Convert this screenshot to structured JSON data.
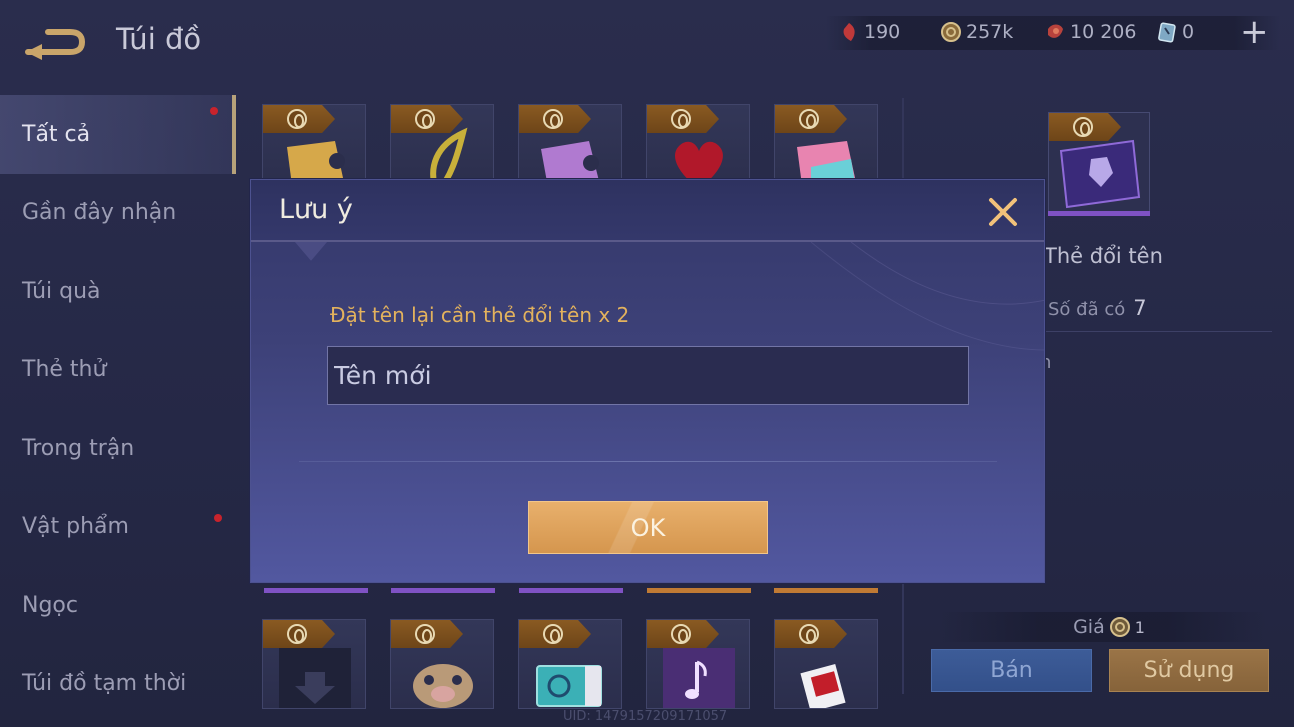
{
  "header": {
    "title": "Túi đồ",
    "currencies": [
      {
        "icon": "ruby-icon",
        "value": "190"
      },
      {
        "icon": "gold-coin-icon",
        "value": "257k"
      },
      {
        "icon": "voucher-icon",
        "value": "10 206"
      },
      {
        "icon": "card-icon",
        "value": "0"
      }
    ],
    "plus_label": "+"
  },
  "sidebar": {
    "items": [
      {
        "label": "Tất cả",
        "active": true,
        "badge": true
      },
      {
        "label": "Gần đây nhận",
        "active": false,
        "badge": false
      },
      {
        "label": "Túi quà",
        "active": false,
        "badge": false
      },
      {
        "label": "Thẻ thử",
        "active": false,
        "badge": false
      },
      {
        "label": "Trong trận",
        "active": false,
        "badge": false
      },
      {
        "label": "Vật phẩm",
        "active": false,
        "badge": true
      },
      {
        "label": "Ngọc",
        "active": false,
        "badge": false
      },
      {
        "label": "Túi đồ tạm thời",
        "active": false,
        "badge": false
      }
    ]
  },
  "detail": {
    "item_name": "Thẻ đổi tên",
    "owned_label": "Số đã có",
    "owned_value": "7",
    "desc_fragment": "n",
    "price_label": "Giá",
    "price_value": "1",
    "sell_label": "Bán",
    "use_label": "Sử dụng"
  },
  "uid": "UID: 1479157209171057",
  "modal": {
    "title": "Lưu ý",
    "message": "Đặt tên lại cần thẻ đổi tên x 2",
    "input_placeholder": "Tên mới",
    "ok_label": "OK"
  },
  "colors": {
    "accent_gold": "#e3b25d",
    "button_orange": "#d5964e",
    "modal_bg": "#3d4178",
    "rarity_purple": "#7f52c4",
    "rarity_orange": "#c07a34",
    "badge_red": "#c8232c"
  }
}
